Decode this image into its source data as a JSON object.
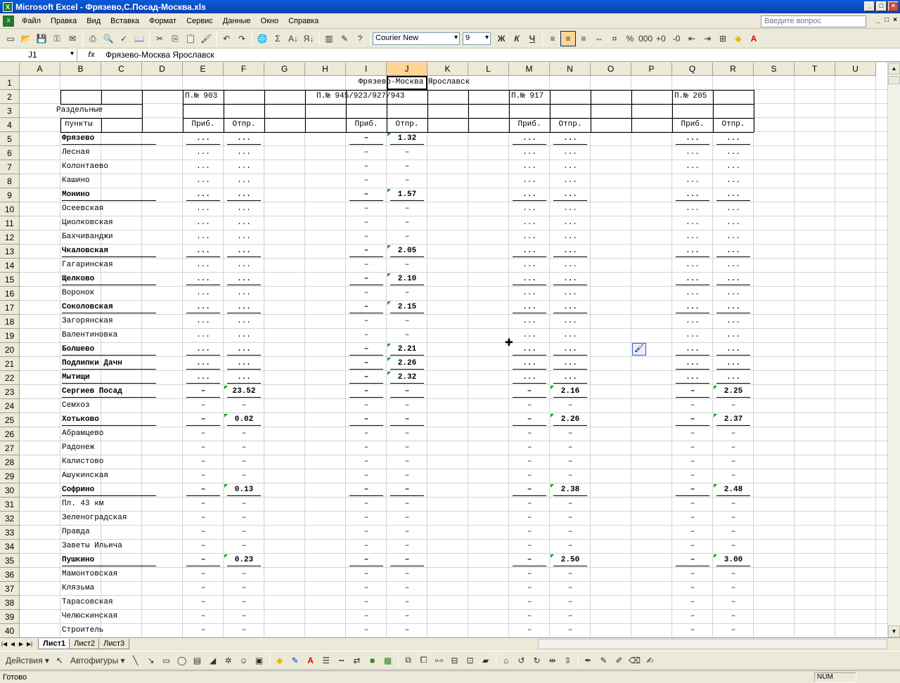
{
  "window": {
    "title": "Microsoft Excel - Фрязево,С.Посад-Москва.xls",
    "app_icon": "X"
  },
  "menu": [
    "Файл",
    "Правка",
    "Вид",
    "Вставка",
    "Формат",
    "Сервис",
    "Данные",
    "Окно",
    "Справка"
  ],
  "help_placeholder": "Введите вопрос",
  "font": {
    "name": "Courier New",
    "size": "9"
  },
  "format_buttons": {
    "bold": "Ж",
    "italic": "К",
    "underline": "Ч"
  },
  "namebox": "J1",
  "formula": "Фрязево-Москва Ярославск",
  "columns": [
    "A",
    "B",
    "C",
    "D",
    "E",
    "F",
    "G",
    "H",
    "I",
    "J",
    "K",
    "L",
    "M",
    "N",
    "O",
    "P",
    "Q",
    "R",
    "S",
    "T",
    "U"
  ],
  "selected_col": "J",
  "rows_count": 40,
  "header": {
    "title": "Фрязево-Москва Ярославск",
    "train_e": "П.№ 903",
    "train_i": "П.№  945/923/927/943",
    "train_m": "П.№ 917",
    "train_q": "П.№ 205",
    "label1": "Раздельные",
    "label2": "пункты",
    "arr": "Приб.",
    "dep": "Отпр."
  },
  "stations": [
    {
      "name": "Фрязево",
      "bold": true,
      "e": "...",
      "f": "...",
      "i": "–",
      "j": "1.32",
      "m": "...",
      "n": "...",
      "q": "...",
      "r": "..."
    },
    {
      "name": "Лесная",
      "bold": false,
      "e": "...",
      "f": "...",
      "i": "–",
      "j": "–",
      "m": "...",
      "n": "...",
      "q": "...",
      "r": "..."
    },
    {
      "name": "Колонтаево",
      "bold": false,
      "e": "...",
      "f": "...",
      "i": "–",
      "j": "–",
      "m": "...",
      "n": "...",
      "q": "...",
      "r": "..."
    },
    {
      "name": "Кашино",
      "bold": false,
      "e": "...",
      "f": "...",
      "i": "–",
      "j": "–",
      "m": "...",
      "n": "...",
      "q": "...",
      "r": "..."
    },
    {
      "name": "Монино",
      "bold": true,
      "e": "...",
      "f": "...",
      "i": "–",
      "j": "1.57",
      "m": "...",
      "n": "...",
      "q": "...",
      "r": "..."
    },
    {
      "name": "Осеевская",
      "bold": false,
      "e": "...",
      "f": "...",
      "i": "–",
      "j": "–",
      "m": "...",
      "n": "...",
      "q": "...",
      "r": "..."
    },
    {
      "name": "Циолковская",
      "bold": false,
      "e": "...",
      "f": "...",
      "i": "–",
      "j": "–",
      "m": "...",
      "n": "...",
      "q": "...",
      "r": "..."
    },
    {
      "name": "Бахчиванджи",
      "bold": false,
      "e": "...",
      "f": "...",
      "i": "–",
      "j": "–",
      "m": "...",
      "n": "...",
      "q": "...",
      "r": "..."
    },
    {
      "name": "Чкаловская",
      "bold": true,
      "e": "...",
      "f": "...",
      "i": "–",
      "j": "2.05",
      "m": "...",
      "n": "...",
      "q": "...",
      "r": "..."
    },
    {
      "name": "Гагаринская",
      "bold": false,
      "e": "...",
      "f": "...",
      "i": "–",
      "j": "–",
      "m": "...",
      "n": "...",
      "q": "...",
      "r": "..."
    },
    {
      "name": "Щелково",
      "bold": true,
      "e": "...",
      "f": "...",
      "i": "–",
      "j": "2.10",
      "m": "...",
      "n": "...",
      "q": "...",
      "r": "..."
    },
    {
      "name": "Воронок",
      "bold": false,
      "e": "...",
      "f": "...",
      "i": "–",
      "j": "–",
      "m": "...",
      "n": "...",
      "q": "...",
      "r": "..."
    },
    {
      "name": "Соколовская",
      "bold": true,
      "e": "...",
      "f": "...",
      "i": "–",
      "j": "2.15",
      "m": "...",
      "n": "...",
      "q": "...",
      "r": "..."
    },
    {
      "name": "Загорянская",
      "bold": false,
      "e": "...",
      "f": "...",
      "i": "–",
      "j": "–",
      "m": "...",
      "n": "...",
      "q": "...",
      "r": "..."
    },
    {
      "name": "Валентиновка",
      "bold": false,
      "e": "...",
      "f": "...",
      "i": "–",
      "j": "–",
      "m": "...",
      "n": "...",
      "q": "...",
      "r": "..."
    },
    {
      "name": "Болшево",
      "bold": true,
      "e": "...",
      "f": "...",
      "i": "–",
      "j": "2.21",
      "m": "...",
      "n": "...",
      "q": "...",
      "r": "..."
    },
    {
      "name": "Подлипки Дачн",
      "bold": true,
      "e": "...",
      "f": "...",
      "i": "–",
      "j": "2.26",
      "m": "...",
      "n": "...",
      "q": "...",
      "r": "..."
    },
    {
      "name": "Мытищи",
      "bold": true,
      "e": "...",
      "f": "...",
      "i": "–",
      "j": "2.32",
      "m": "...",
      "n": "...",
      "q": "...",
      "r": "..."
    },
    {
      "name": "Сергиев Посад",
      "bold": true,
      "e": "–",
      "f": "23.52",
      "i": "–",
      "j": "–",
      "m": "–",
      "n": "2.16",
      "q": "–",
      "r": "2.25"
    },
    {
      "name": "Семхоз",
      "bold": false,
      "e": "–",
      "f": "–",
      "i": "–",
      "j": "–",
      "m": "–",
      "n": "–",
      "q": "–",
      "r": "–"
    },
    {
      "name": "Хотьково",
      "bold": true,
      "e": "–",
      "f": "0.02",
      "i": "–",
      "j": "–",
      "m": "–",
      "n": "2.26",
      "q": "–",
      "r": "2.37"
    },
    {
      "name": "Абрамцево",
      "bold": false,
      "e": "–",
      "f": "–",
      "i": "–",
      "j": "–",
      "m": "–",
      "n": "–",
      "q": "–",
      "r": "–"
    },
    {
      "name": "Радонеж",
      "bold": false,
      "e": "–",
      "f": "–",
      "i": "–",
      "j": "–",
      "m": "–",
      "n": "–",
      "q": "–",
      "r": "–"
    },
    {
      "name": "Калистово",
      "bold": false,
      "e": "–",
      "f": "–",
      "i": "–",
      "j": "–",
      "m": "–",
      "n": "–",
      "q": "–",
      "r": "–"
    },
    {
      "name": "Ашукинская",
      "bold": false,
      "e": "–",
      "f": "–",
      "i": "–",
      "j": "–",
      "m": "–",
      "n": "–",
      "q": "–",
      "r": "–"
    },
    {
      "name": "Софрино",
      "bold": true,
      "e": "–",
      "f": "0.13",
      "i": "–",
      "j": "–",
      "m": "–",
      "n": "2.38",
      "q": "–",
      "r": "2.48"
    },
    {
      "name": "Пл. 43 км",
      "bold": false,
      "e": "–",
      "f": "–",
      "i": "–",
      "j": "–",
      "m": "–",
      "n": "–",
      "q": "–",
      "r": "–"
    },
    {
      "name": "Зеленоградская",
      "bold": false,
      "e": "–",
      "f": "–",
      "i": "–",
      "j": "–",
      "m": "–",
      "n": "–",
      "q": "–",
      "r": "–"
    },
    {
      "name": "Правда",
      "bold": false,
      "e": "–",
      "f": "–",
      "i": "–",
      "j": "–",
      "m": "–",
      "n": "–",
      "q": "–",
      "r": "–"
    },
    {
      "name": "Заветы Ильича",
      "bold": false,
      "e": "–",
      "f": "–",
      "i": "–",
      "j": "–",
      "m": "–",
      "n": "–",
      "q": "–",
      "r": "–"
    },
    {
      "name": "Пушкино",
      "bold": true,
      "e": "–",
      "f": "0.23",
      "i": "–",
      "j": "–",
      "m": "–",
      "n": "2.50",
      "q": "–",
      "r": "3.00"
    },
    {
      "name": "Мамонтовская",
      "bold": false,
      "e": "–",
      "f": "–",
      "i": "–",
      "j": "–",
      "m": "–",
      "n": "–",
      "q": "–",
      "r": "–"
    },
    {
      "name": "Клязьма",
      "bold": false,
      "e": "–",
      "f": "–",
      "i": "–",
      "j": "–",
      "m": "–",
      "n": "–",
      "q": "–",
      "r": "–"
    },
    {
      "name": "Тарасовская",
      "bold": false,
      "e": "–",
      "f": "–",
      "i": "–",
      "j": "–",
      "m": "–",
      "n": "–",
      "q": "–",
      "r": "–"
    },
    {
      "name": "Челюскинская",
      "bold": false,
      "e": "–",
      "f": "–",
      "i": "–",
      "j": "–",
      "m": "–",
      "n": "–",
      "q": "–",
      "r": "–"
    },
    {
      "name": "Строитель",
      "bold": false,
      "e": "–",
      "f": "–",
      "i": "–",
      "j": "–",
      "m": "–",
      "n": "–",
      "q": "–",
      "r": "–"
    }
  ],
  "sheets": [
    "Лист1",
    "Лист2",
    "Лист3"
  ],
  "active_sheet": "Лист1",
  "drawing": {
    "actions": "Действия",
    "autoshapes": "Автофигуры"
  },
  "status": {
    "ready": "Готово",
    "num": "NUM"
  },
  "colors": {
    "title_bar": "#0a4cc8",
    "selected_header": "#ffd595",
    "comment_tri": "#00a000"
  }
}
